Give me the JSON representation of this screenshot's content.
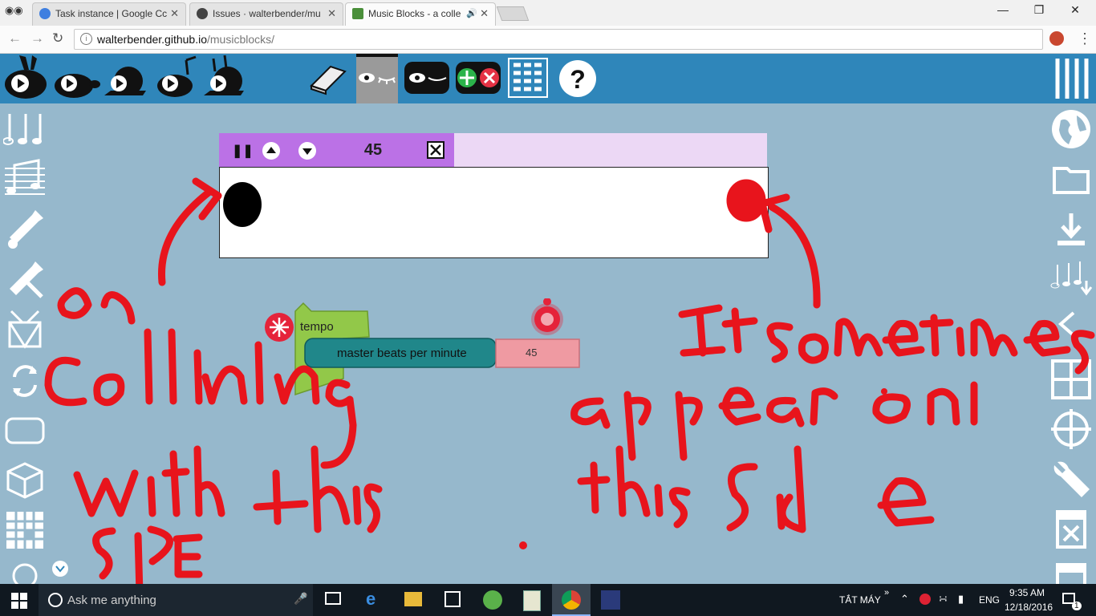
{
  "browser": {
    "tabs": [
      {
        "title": "Task instance | Google Cc",
        "active": false
      },
      {
        "title": "Issues · walterbender/mu",
        "active": false
      },
      {
        "title": "Music Blocks - a colle",
        "active": true
      }
    ],
    "address": {
      "host": "walterbender.github.io",
      "path": "/musicblocks/"
    }
  },
  "widget": {
    "value": "45"
  },
  "blocks": {
    "tempo_label": "tempo",
    "bpm_label": "master beats per minute",
    "bpm_value": "45"
  },
  "annotations": {
    "left_text": "on colliding with this side",
    "right_text": "It sometimes appear on this side",
    "color": "#e8141c"
  },
  "taskbar": {
    "search_placeholder": "Ask me anything",
    "keyboard_label": "TẮT MÁY",
    "language": "ENG",
    "time": "9:35 AM",
    "date": "12/18/2016",
    "notification_count": "1"
  },
  "colors": {
    "toolbar": "#2f86ba",
    "canvas": "#96b8cc",
    "widget_bar": "#bb71e6",
    "tempo_block": "#92c849",
    "bpm_block": "#20878a",
    "number_block": "#ef9aa2"
  }
}
